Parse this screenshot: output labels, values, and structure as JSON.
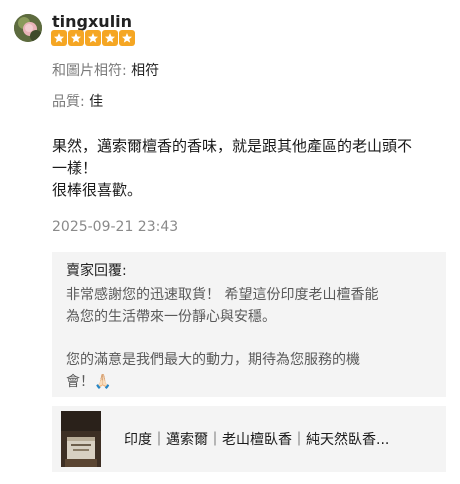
{
  "review": {
    "username": "tingxulin",
    "rating": 5,
    "attributes": [
      {
        "label": "和圖片相符:",
        "value": "相符"
      },
      {
        "label": "品質:",
        "value": "佳"
      }
    ],
    "body_lines": [
      "果然，邁索爾檀香的香味，就是跟其他產區的老山頭不",
      "一樣！",
      "很棒很喜歡。"
    ],
    "date": "2025-09-21 23:43"
  },
  "seller_reply": {
    "title": "賣家回覆:",
    "paragraph1_lines": [
      "非常感謝您的迅速取貨！ 希望這份印度老山檀香能",
      "為您的生活帶來一份靜心與安穩。"
    ],
    "paragraph2_lines": [
      "您的滿意是我們最大的動力，期待為您服務的機",
      "會！🙏🏻"
    ]
  },
  "product": {
    "title": "印度｜邁索爾｜老山檀臥香｜純天然臥香..."
  },
  "colors": {
    "star": "#f5a623",
    "box_bg": "#f4f4f4",
    "label_gray": "#7a7a7a"
  }
}
